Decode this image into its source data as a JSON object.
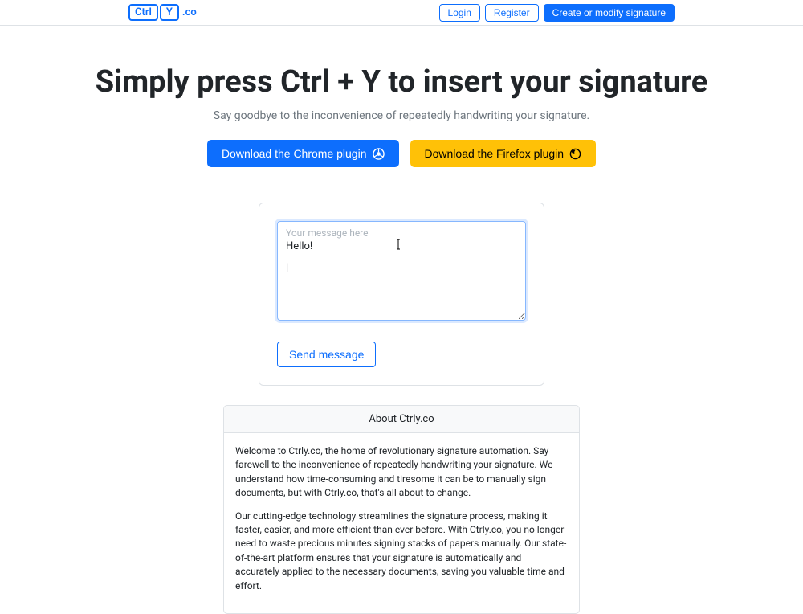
{
  "logo": {
    "part1": "Ctrl",
    "part2": "Y",
    "suffix": ".co"
  },
  "nav": {
    "login": "Login",
    "register": "Register",
    "create": "Create or modify signature"
  },
  "hero": {
    "title": "Simply press Ctrl + Y to insert your signature",
    "subtitle": "Say goodbye to the inconvenience of repeatedly handwriting your signature.",
    "download_chrome": "Download the Chrome plugin",
    "download_firefox": "Download the Firefox plugin"
  },
  "demo": {
    "placeholder": "Your message here",
    "text_line1": "Hello!",
    "caret": "|",
    "send": "Send message"
  },
  "about": {
    "header": "About Ctrly.co",
    "p1": "Welcome to Ctrly.co, the home of revolutionary signature automation. Say farewell to the inconvenience of repeatedly handwriting your signature. We understand how time-consuming and tiresome it can be to manually sign documents, but with Ctrly.co, that's all about to change.",
    "p2": "Our cutting-edge technology streamlines the signature process, making it faster, easier, and more efficient than ever before. With Ctrly.co, you no longer need to waste precious minutes signing stacks of papers manually. Our state-of-the-art platform ensures that your signature is automatically and accurately applied to the necessary documents, saving you valuable time and effort."
  }
}
